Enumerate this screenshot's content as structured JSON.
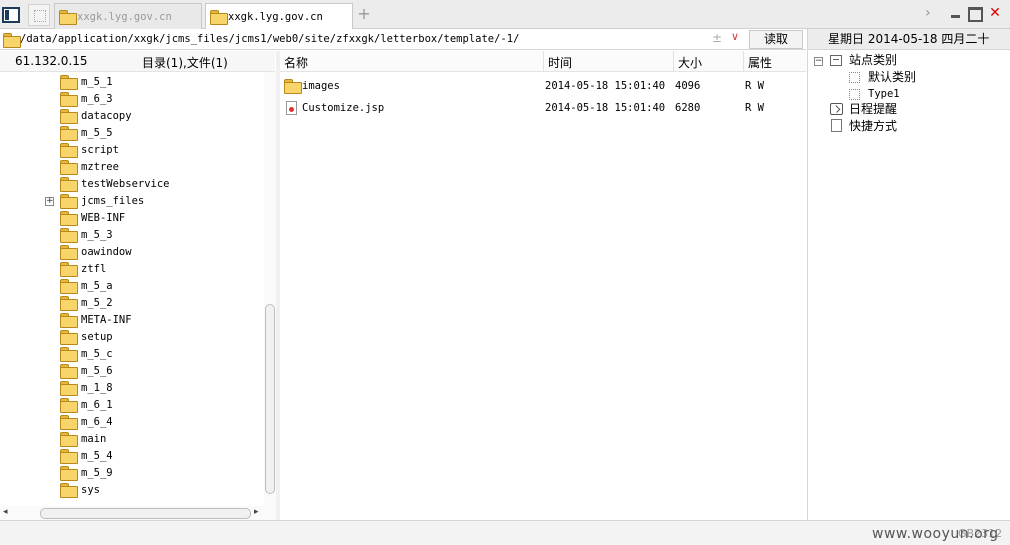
{
  "tabs": [
    {
      "label": "xxgk.lyg.gov.cn",
      "active": false
    },
    {
      "label": "xxgk.lyg.gov.cn",
      "active": true
    }
  ],
  "address": {
    "path": "/data/application/xxgk/jcms_files/jcms1/web0/site/zfxxgk/letterbox/template/-1/",
    "plus_symbol": "±",
    "dropdown_symbol": "∨",
    "read_label": "读取"
  },
  "left_panel": {
    "server_ip": "61.132.0.15",
    "summary": "目录(1),文件(1)",
    "folders": [
      "m_5_1",
      "m_6_3",
      "datacopy",
      "m_5_5",
      "script",
      "mztree",
      "testWebservice",
      "jcms_files",
      "WEB-INF",
      "m_5_3",
      "oawindow",
      "ztfl",
      "m_5_a",
      "m_5_2",
      "META-INF",
      "setup",
      "m_5_c",
      "m_5_6",
      "m_1_8",
      "m_6_1",
      "m_6_4",
      "main",
      "m_5_4",
      "m_5_9",
      "sys"
    ],
    "expandable_folder": "jcms_files",
    "expand_symbol": "+"
  },
  "file_list": {
    "columns": {
      "name": "名称",
      "time": "时间",
      "size": "大小",
      "attr": "属性"
    },
    "rows": [
      {
        "name": "images",
        "time": "2014-05-18 15:01:40",
        "size": "4096",
        "attr": "R W",
        "type": "folder"
      },
      {
        "name": "Customize.jsp",
        "time": "2014-05-18 15:01:40",
        "size": "6280",
        "attr": "R W",
        "type": "file"
      }
    ]
  },
  "right_panel": {
    "date_header": "星期日 2014-05-18 四月二十",
    "collapse_symbol": "−",
    "items": [
      {
        "label": "站点类别",
        "level": 0
      },
      {
        "label": "默认类别",
        "level": 1
      },
      {
        "label": "Type1",
        "level": 1
      },
      {
        "label": "日程提醒",
        "level": 0
      },
      {
        "label": "快捷方式",
        "level": 0
      }
    ]
  },
  "window": {
    "new_tab": "+",
    "scroll_right": "›",
    "close": "✕"
  },
  "status": {
    "text": "GB2312"
  },
  "watermark": "www.wooyun.org"
}
